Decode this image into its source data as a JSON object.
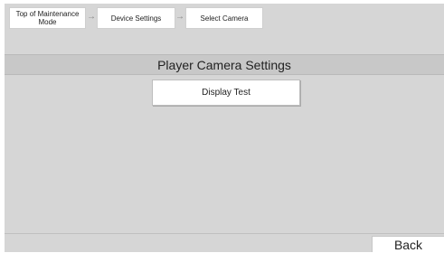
{
  "breadcrumb": {
    "items": [
      {
        "label": "Top of Maintenance Mode"
      },
      {
        "label": "Device Settings"
      },
      {
        "label": "Select Camera"
      }
    ],
    "separator": "→"
  },
  "page": {
    "title": "Player Camera Settings"
  },
  "actions": {
    "display_test_label": "Display Test",
    "back_label": "Back"
  },
  "colors": {
    "background": "#d6d6d6",
    "title_bar": "#c8c8c8",
    "button": "#ffffff",
    "text": "#222222"
  }
}
